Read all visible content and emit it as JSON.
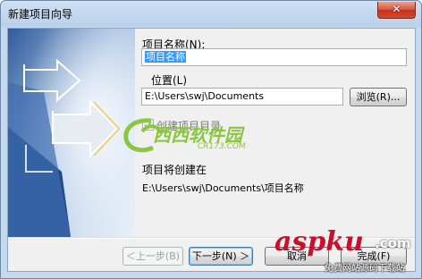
{
  "window": {
    "title": "新建项目向导",
    "close_glyph": "✕"
  },
  "form": {
    "name_label": "项目名称(N):",
    "name_value": "项目名称",
    "location_label": "位置(L)",
    "location_value": "E:\\Users\\swj\\Documents",
    "browse_label": "浏览(R)...",
    "create_dir_label": "创建项目目录",
    "create_dir_checked": true,
    "result_label": "项目将创建在",
    "result_path": "E:\\Users\\swj\\Documents\\项目名称"
  },
  "buttons": {
    "back": "＜上一步(B)",
    "next": "下一步(N) ＞",
    "cancel": "取消",
    "finish": "完成(F)"
  },
  "watermarks": {
    "cr173_brand": "西西软件园",
    "cr173_url": "CR173.COM",
    "aspku_brand": "aspku",
    "aspku_com": ".com",
    "aspku_tagline": "免费网站源码下载站"
  },
  "colors": {
    "accent_blue": "#3399ff",
    "selection": "#3399ff",
    "watermark_green": "#8cc63f",
    "watermark_red": "#c8102e"
  }
}
